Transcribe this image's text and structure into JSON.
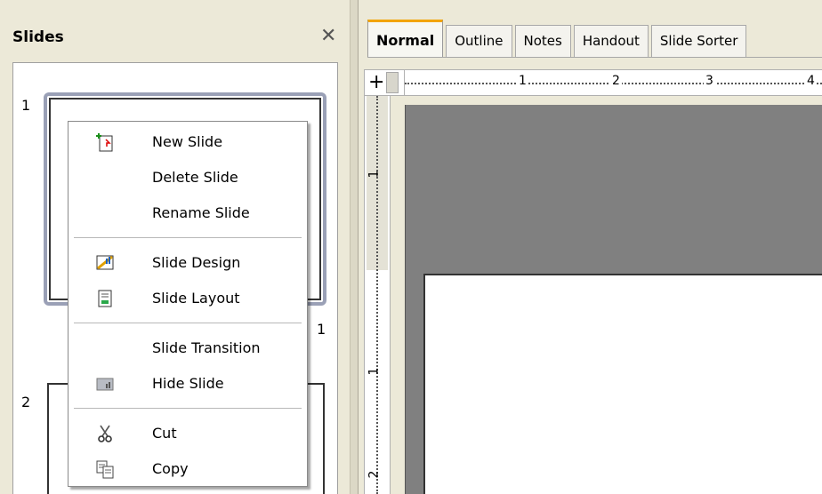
{
  "slides_pane": {
    "title": "Slides",
    "close_glyph": "✕",
    "slides": [
      {
        "number": "1",
        "label": "1"
      },
      {
        "number": "2"
      }
    ]
  },
  "tabs": [
    {
      "label": "Normal",
      "active": true
    },
    {
      "label": "Outline"
    },
    {
      "label": "Notes"
    },
    {
      "label": "Handout"
    },
    {
      "label": "Slide Sorter"
    }
  ],
  "ruler": {
    "horizontal_ticks": [
      "1",
      "2",
      "3",
      "4"
    ],
    "vertical_ticks": [
      "1",
      "1",
      "2"
    ],
    "corner_glyph": "+"
  },
  "context_menu": {
    "items": [
      {
        "label": "New Slide",
        "icon": "new-slide-icon"
      },
      {
        "label": "Delete Slide"
      },
      {
        "label": "Rename Slide"
      },
      {
        "label": "Slide Design",
        "icon": "slide-design-icon"
      },
      {
        "label": "Slide Layout",
        "icon": "slide-layout-icon"
      },
      {
        "label": "Slide Transition"
      },
      {
        "label": "Hide Slide",
        "icon": "hide-slide-icon"
      },
      {
        "label": "Cut",
        "icon": "cut-icon"
      },
      {
        "label": "Copy",
        "icon": "copy-icon"
      }
    ]
  },
  "colors": {
    "active_tab_accent": "#f2a400",
    "workspace_gray": "#808080",
    "selected_slide_border": "#9aa0b6"
  }
}
